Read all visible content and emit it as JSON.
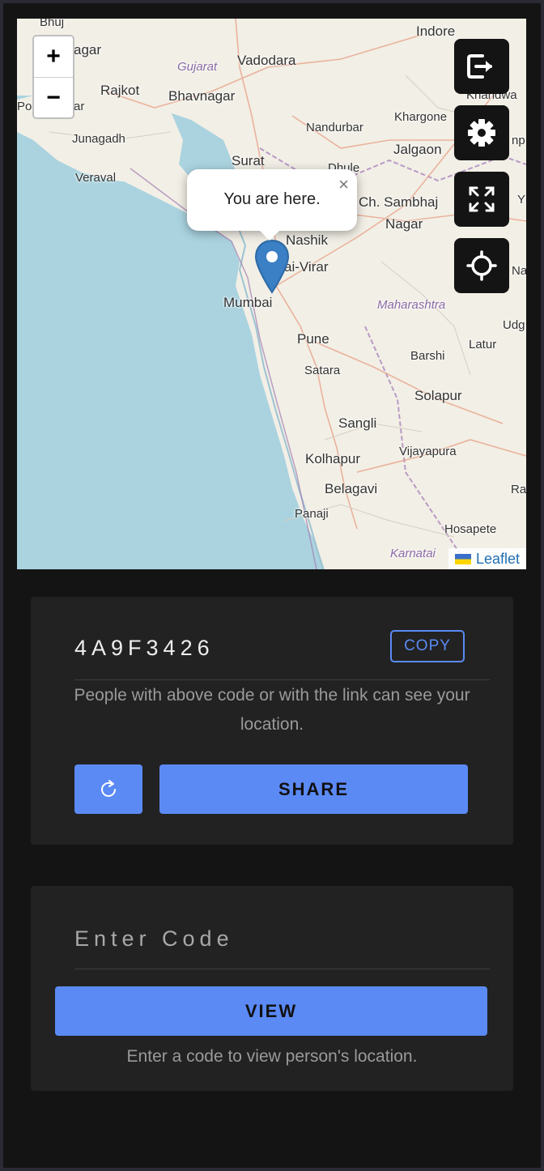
{
  "map": {
    "zoom_in": "+",
    "zoom_out": "−",
    "popup_text": "You are here.",
    "popup_close": "×",
    "attribution": "Leaflet",
    "places": [
      {
        "name": "Bhuj"
      },
      {
        "name": "agar"
      },
      {
        "name": "Vadodara"
      },
      {
        "name": "Indore"
      },
      {
        "name": "Gujarat",
        "kind": "state"
      },
      {
        "name": "Rajkot"
      },
      {
        "name": "Bhavnagar"
      },
      {
        "name": "Khandwa"
      },
      {
        "name": "Po"
      },
      {
        "name": "ar"
      },
      {
        "name": "Nandurbar"
      },
      {
        "name": "Khargone"
      },
      {
        "name": "Junagadh"
      },
      {
        "name": "Surat"
      },
      {
        "name": "Jalgaon"
      },
      {
        "name": "Dhule"
      },
      {
        "name": "Veraval"
      },
      {
        "name": "Ch. Sambhaj"
      },
      {
        "name": "Nagar"
      },
      {
        "name": "Nashik"
      },
      {
        "name": "ai-Virar"
      },
      {
        "name": "Mumbai"
      },
      {
        "name": "Maharashtra",
        "kind": "state"
      },
      {
        "name": "Pune"
      },
      {
        "name": "Udg"
      },
      {
        "name": "Latur"
      },
      {
        "name": "Barshi"
      },
      {
        "name": "Satara"
      },
      {
        "name": "Solapur"
      },
      {
        "name": "Sangli"
      },
      {
        "name": "Vijayapura"
      },
      {
        "name": "Kolhapur"
      },
      {
        "name": "Belagavi"
      },
      {
        "name": "Ra"
      },
      {
        "name": "Panaji"
      },
      {
        "name": "Hosapete"
      },
      {
        "name": "Karnatai",
        "kind": "state"
      },
      {
        "name": "Nai"
      },
      {
        "name": "Y"
      },
      {
        "name": "np"
      }
    ]
  },
  "controls": {
    "exit_icon": "exit-icon",
    "settings_icon": "gear-icon",
    "fullscreen_icon": "fullscreen-icon",
    "locate_icon": "crosshair-icon"
  },
  "share_card": {
    "code": "4A9F3426",
    "copy_label": "COPY",
    "info_text": "People with above code or with the link can see your location.",
    "refresh_icon": "refresh-icon",
    "share_label": "SHARE"
  },
  "view_card": {
    "input_placeholder": "Enter Code",
    "input_value": "",
    "view_label": "VIEW",
    "info_text": "Enter a code to view person's location."
  },
  "colors": {
    "accent": "#5b8af5",
    "background": "#141414",
    "card": "#222222",
    "sea": "#aad3df",
    "land": "#f2efe6"
  }
}
